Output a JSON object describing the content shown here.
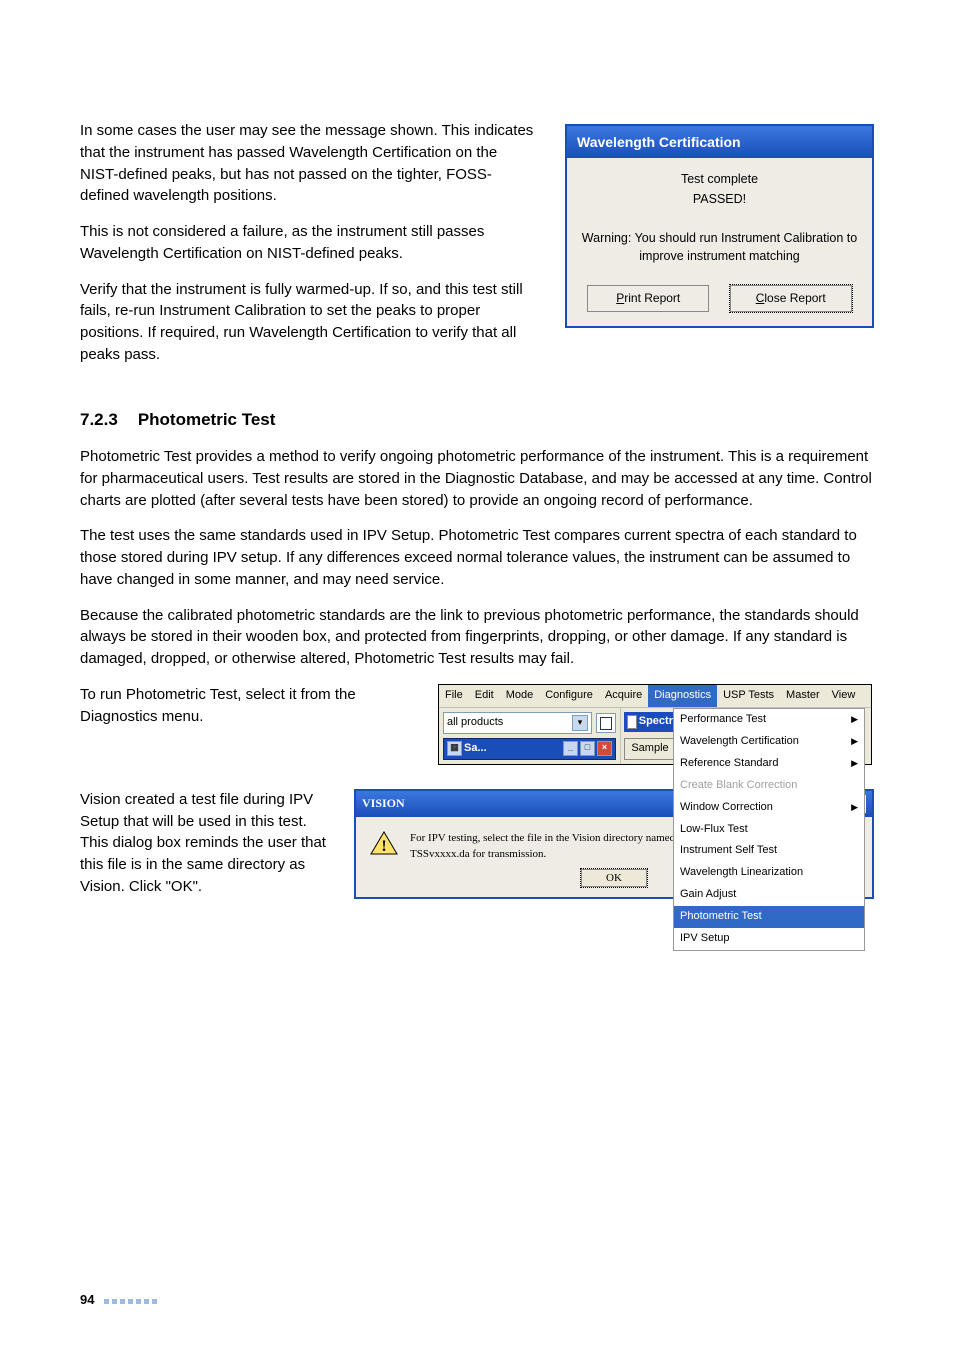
{
  "row1": {
    "p1": "In some cases the user may see the message shown. This indicates that the instrument has passed Wavelength Certification on the NIST-defined peaks, but has not passed on the tighter, FOSS-defined wavelength positions.",
    "p2": "This is not considered a failure, as the instrument still passes Wavelength Certification on NIST-defined peaks.",
    "p3": "Verify that the instrument is fully warmed-up. If so, and this test still fails, re-run Instrument Calibration to set the peaks to proper positions. If required, run Wavelength Certification to verify that all peaks pass."
  },
  "wave_dialog": {
    "title": "Wavelength Certification",
    "complete": "Test complete",
    "passed": "PASSED!",
    "warning": "Warning: You should run Instrument Calibration to improve instrument matching",
    "print": "Print Report",
    "close": "Close Report"
  },
  "section": {
    "num": "7.2.3",
    "title": "Photometric Test"
  },
  "body": {
    "p4": "Photometric Test provides a method to verify ongoing photometric performance of the instrument. This is a requirement for pharmaceutical users. Test results are stored in the Diagnostic Database, and may be accessed at any time. Control charts are plotted (after several tests have been stored) to provide an ongoing record of performance.",
    "p5": "The test uses the same standards used in IPV Setup. Photometric Test compares current spectra of each standard to those stored during IPV setup. If any differences exceed normal tolerance values, the instrument can be assumed to have changed in some manner, and may need service.",
    "p6": "Because the calibrated photometric standards are the link to previous photometric performance, the standards should always be stored in their wooden box, and protected from fingerprints, dropping, or other damage. If any standard is damaged, dropped, or otherwise altered, Photometric Test results may fail.",
    "p7": "To run Photometric Test, select it from the Diagnostics menu."
  },
  "menubar": [
    "File",
    "Edit",
    "Mode",
    "Configure",
    "Acquire",
    "Diagnostics",
    "USP Tests",
    "Master",
    "View"
  ],
  "menubar_selected_index": 5,
  "combo_value": "all products",
  "subwin_title": "Sa...",
  "spectr": "Spectr",
  "sample_btn": "Sample",
  "dropdown": {
    "items": [
      {
        "label": "Performance Test",
        "arrow": true
      },
      {
        "label": "Wavelength Certification",
        "arrow": true
      },
      {
        "label": "Reference Standard",
        "arrow": true
      },
      {
        "label": "Create Blank Correction",
        "disabled": true
      },
      {
        "label": "Window Correction",
        "arrow": true
      },
      {
        "label": "Low-Flux Test"
      },
      {
        "label": "Instrument Self Test"
      },
      {
        "label": "Wavelength Linearization"
      },
      {
        "label": "Gain Adjust"
      },
      {
        "label": "Photometric Test",
        "selected": true
      },
      {
        "label": "IPV Setup"
      }
    ]
  },
  "row3_text": "Vision created a test file during IPV Setup that will be used in this test. This dialog box reminds the user that this file is in the same directory as Vision. Click \"OK\".",
  "msgbox": {
    "title": "VISION",
    "text": "For IPV testing, select the file in the Vision directory named RSSvxxxx.da for reflectance, or TSSvxxxx.da for transmission.",
    "ok": "OK"
  },
  "footer_page": "94"
}
